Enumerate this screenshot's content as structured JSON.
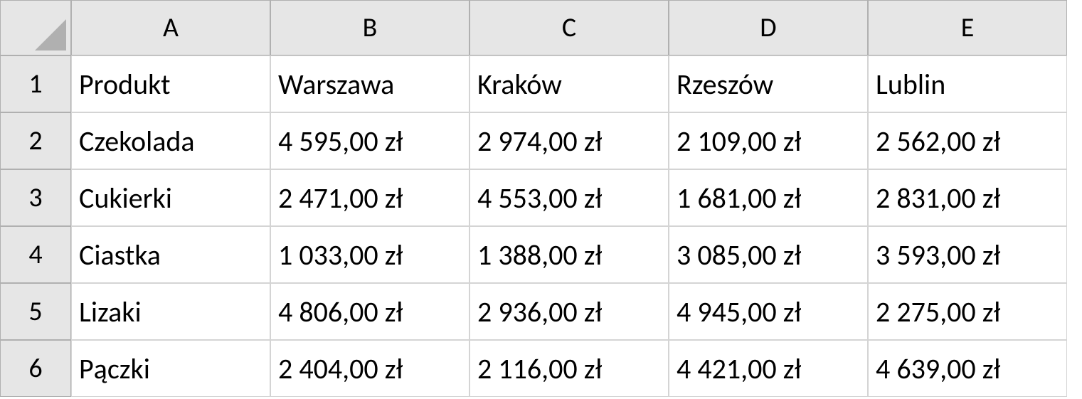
{
  "columns": [
    "A",
    "B",
    "C",
    "D",
    "E"
  ],
  "rows": [
    "1",
    "2",
    "3",
    "4",
    "5",
    "6"
  ],
  "cells": {
    "r0": {
      "c0": "Produkt",
      "c1": "Warszawa",
      "c2": "Kraków",
      "c3": "Rzeszów",
      "c4": "Lublin"
    },
    "r1": {
      "c0": "Czekolada",
      "c1": "4 595,00 zł",
      "c2": "2 974,00 zł",
      "c3": "2 109,00 zł",
      "c4": "2 562,00 zł"
    },
    "r2": {
      "c0": "Cukierki",
      "c1": "2 471,00 zł",
      "c2": "4 553,00 zł",
      "c3": "1 681,00 zł",
      "c4": "2 831,00 zł"
    },
    "r3": {
      "c0": "Ciastka",
      "c1": "1 033,00 zł",
      "c2": "1 388,00 zł",
      "c3": "3 085,00 zł",
      "c4": "3 593,00 zł"
    },
    "r4": {
      "c0": "Lizaki",
      "c1": "4 806,00 zł",
      "c2": "2 936,00 zł",
      "c3": "4 945,00 zł",
      "c4": "2 275,00 zł"
    },
    "r5": {
      "c0": "Pączki",
      "c1": "2 404,00 zł",
      "c2": "2 116,00 zł",
      "c3": "4 421,00 zł",
      "c4": "4 639,00 zł"
    }
  }
}
